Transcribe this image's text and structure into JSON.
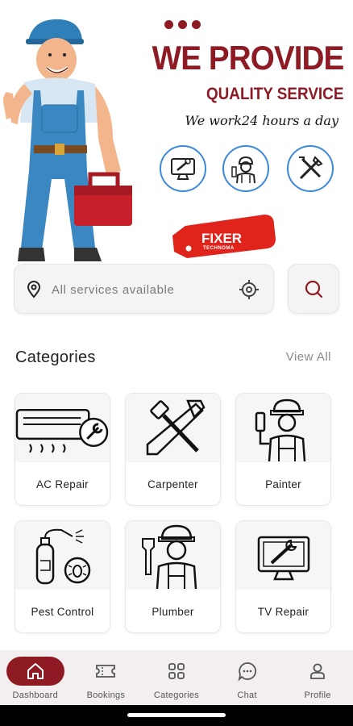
{
  "banner": {
    "headline": "WE PROVIDE",
    "subhead": "QUALITY SERVICE",
    "tagline": "We work24 hours a day",
    "tag_title": "FIXER",
    "tag_sub": "TECHNOMA"
  },
  "search": {
    "placeholder": "All services available"
  },
  "categories": {
    "title": "Categories",
    "view_all": "View All",
    "items": [
      {
        "label": "AC Repair",
        "icon": "ac-repair-icon"
      },
      {
        "label": "Carpenter",
        "icon": "carpenter-icon"
      },
      {
        "label": "Painter",
        "icon": "painter-icon"
      },
      {
        "label": "Pest Control",
        "icon": "pest-control-icon"
      },
      {
        "label": "Plumber",
        "icon": "plumber-icon"
      },
      {
        "label": "TV Repair",
        "icon": "tv-repair-icon"
      }
    ]
  },
  "nav": {
    "items": [
      {
        "label": "Dashboard",
        "icon": "home-icon",
        "active": true
      },
      {
        "label": "Bookings",
        "icon": "ticket-icon",
        "active": false
      },
      {
        "label": "Categories",
        "icon": "grid-icon",
        "active": false
      },
      {
        "label": "Chat",
        "icon": "chat-icon",
        "active": false
      },
      {
        "label": "Profile",
        "icon": "user-icon",
        "active": false
      }
    ]
  },
  "colors": {
    "brand": "#8e1a24",
    "accent_blue": "#3b8ad9",
    "tag_red": "#e0241b"
  }
}
